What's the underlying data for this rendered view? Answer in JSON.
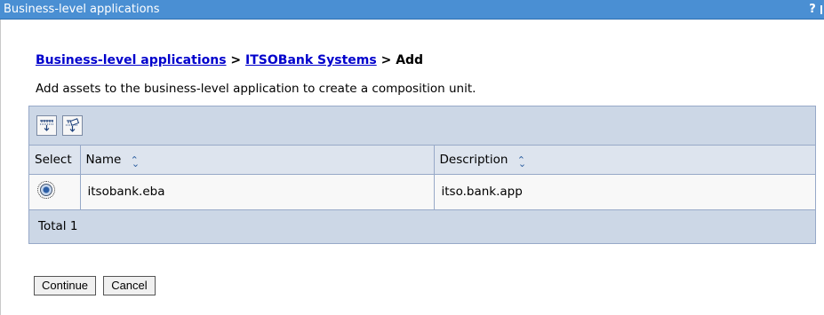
{
  "titlebar": {
    "title": "Business-level applications",
    "help": "?"
  },
  "breadcrumb": {
    "link1": "Business-level applications",
    "sep1": ">",
    "link2": "ITSOBank Systems",
    "sep2": ">",
    "current": "Add"
  },
  "intro": "Add assets to the business-level application to create a composition unit.",
  "toolbar": {
    "icons": [
      "select-all-icon",
      "deselect-all-icon"
    ]
  },
  "table": {
    "headers": {
      "select": "Select",
      "name": "Name",
      "description": "Description"
    },
    "sort_icon": "sort-icon",
    "rows": [
      {
        "name": "itsobank.eba",
        "description": "itso.bank.app"
      }
    ],
    "total": "Total 1"
  },
  "buttons": {
    "continue": "Continue",
    "cancel": "Cancel"
  },
  "colors": {
    "titlebar": "#4a8fd3",
    "table_header": "#ccd7e6",
    "link": "#0000cc"
  }
}
